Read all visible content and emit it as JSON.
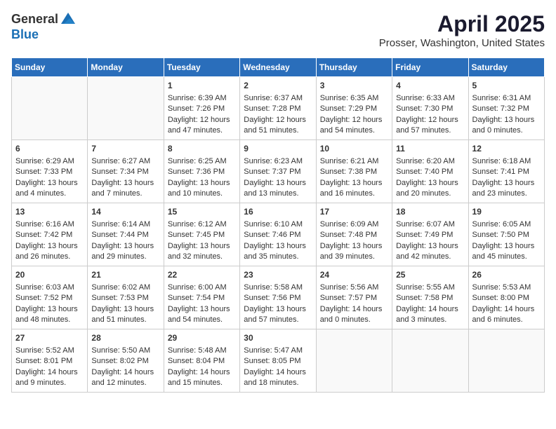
{
  "header": {
    "logo_general": "General",
    "logo_blue": "Blue",
    "title": "April 2025",
    "subtitle": "Prosser, Washington, United States"
  },
  "calendar": {
    "days_of_week": [
      "Sunday",
      "Monday",
      "Tuesday",
      "Wednesday",
      "Thursday",
      "Friday",
      "Saturday"
    ],
    "weeks": [
      [
        {
          "day": "",
          "content": ""
        },
        {
          "day": "",
          "content": ""
        },
        {
          "day": "1",
          "content": "Sunrise: 6:39 AM\nSunset: 7:26 PM\nDaylight: 12 hours\nand 47 minutes."
        },
        {
          "day": "2",
          "content": "Sunrise: 6:37 AM\nSunset: 7:28 PM\nDaylight: 12 hours\nand 51 minutes."
        },
        {
          "day": "3",
          "content": "Sunrise: 6:35 AM\nSunset: 7:29 PM\nDaylight: 12 hours\nand 54 minutes."
        },
        {
          "day": "4",
          "content": "Sunrise: 6:33 AM\nSunset: 7:30 PM\nDaylight: 12 hours\nand 57 minutes."
        },
        {
          "day": "5",
          "content": "Sunrise: 6:31 AM\nSunset: 7:32 PM\nDaylight: 13 hours\nand 0 minutes."
        }
      ],
      [
        {
          "day": "6",
          "content": "Sunrise: 6:29 AM\nSunset: 7:33 PM\nDaylight: 13 hours\nand 4 minutes."
        },
        {
          "day": "7",
          "content": "Sunrise: 6:27 AM\nSunset: 7:34 PM\nDaylight: 13 hours\nand 7 minutes."
        },
        {
          "day": "8",
          "content": "Sunrise: 6:25 AM\nSunset: 7:36 PM\nDaylight: 13 hours\nand 10 minutes."
        },
        {
          "day": "9",
          "content": "Sunrise: 6:23 AM\nSunset: 7:37 PM\nDaylight: 13 hours\nand 13 minutes."
        },
        {
          "day": "10",
          "content": "Sunrise: 6:21 AM\nSunset: 7:38 PM\nDaylight: 13 hours\nand 16 minutes."
        },
        {
          "day": "11",
          "content": "Sunrise: 6:20 AM\nSunset: 7:40 PM\nDaylight: 13 hours\nand 20 minutes."
        },
        {
          "day": "12",
          "content": "Sunrise: 6:18 AM\nSunset: 7:41 PM\nDaylight: 13 hours\nand 23 minutes."
        }
      ],
      [
        {
          "day": "13",
          "content": "Sunrise: 6:16 AM\nSunset: 7:42 PM\nDaylight: 13 hours\nand 26 minutes."
        },
        {
          "day": "14",
          "content": "Sunrise: 6:14 AM\nSunset: 7:44 PM\nDaylight: 13 hours\nand 29 minutes."
        },
        {
          "day": "15",
          "content": "Sunrise: 6:12 AM\nSunset: 7:45 PM\nDaylight: 13 hours\nand 32 minutes."
        },
        {
          "day": "16",
          "content": "Sunrise: 6:10 AM\nSunset: 7:46 PM\nDaylight: 13 hours\nand 35 minutes."
        },
        {
          "day": "17",
          "content": "Sunrise: 6:09 AM\nSunset: 7:48 PM\nDaylight: 13 hours\nand 39 minutes."
        },
        {
          "day": "18",
          "content": "Sunrise: 6:07 AM\nSunset: 7:49 PM\nDaylight: 13 hours\nand 42 minutes."
        },
        {
          "day": "19",
          "content": "Sunrise: 6:05 AM\nSunset: 7:50 PM\nDaylight: 13 hours\nand 45 minutes."
        }
      ],
      [
        {
          "day": "20",
          "content": "Sunrise: 6:03 AM\nSunset: 7:52 PM\nDaylight: 13 hours\nand 48 minutes."
        },
        {
          "day": "21",
          "content": "Sunrise: 6:02 AM\nSunset: 7:53 PM\nDaylight: 13 hours\nand 51 minutes."
        },
        {
          "day": "22",
          "content": "Sunrise: 6:00 AM\nSunset: 7:54 PM\nDaylight: 13 hours\nand 54 minutes."
        },
        {
          "day": "23",
          "content": "Sunrise: 5:58 AM\nSunset: 7:56 PM\nDaylight: 13 hours\nand 57 minutes."
        },
        {
          "day": "24",
          "content": "Sunrise: 5:56 AM\nSunset: 7:57 PM\nDaylight: 14 hours\nand 0 minutes."
        },
        {
          "day": "25",
          "content": "Sunrise: 5:55 AM\nSunset: 7:58 PM\nDaylight: 14 hours\nand 3 minutes."
        },
        {
          "day": "26",
          "content": "Sunrise: 5:53 AM\nSunset: 8:00 PM\nDaylight: 14 hours\nand 6 minutes."
        }
      ],
      [
        {
          "day": "27",
          "content": "Sunrise: 5:52 AM\nSunset: 8:01 PM\nDaylight: 14 hours\nand 9 minutes."
        },
        {
          "day": "28",
          "content": "Sunrise: 5:50 AM\nSunset: 8:02 PM\nDaylight: 14 hours\nand 12 minutes."
        },
        {
          "day": "29",
          "content": "Sunrise: 5:48 AM\nSunset: 8:04 PM\nDaylight: 14 hours\nand 15 minutes."
        },
        {
          "day": "30",
          "content": "Sunrise: 5:47 AM\nSunset: 8:05 PM\nDaylight: 14 hours\nand 18 minutes."
        },
        {
          "day": "",
          "content": ""
        },
        {
          "day": "",
          "content": ""
        },
        {
          "day": "",
          "content": ""
        }
      ]
    ]
  }
}
